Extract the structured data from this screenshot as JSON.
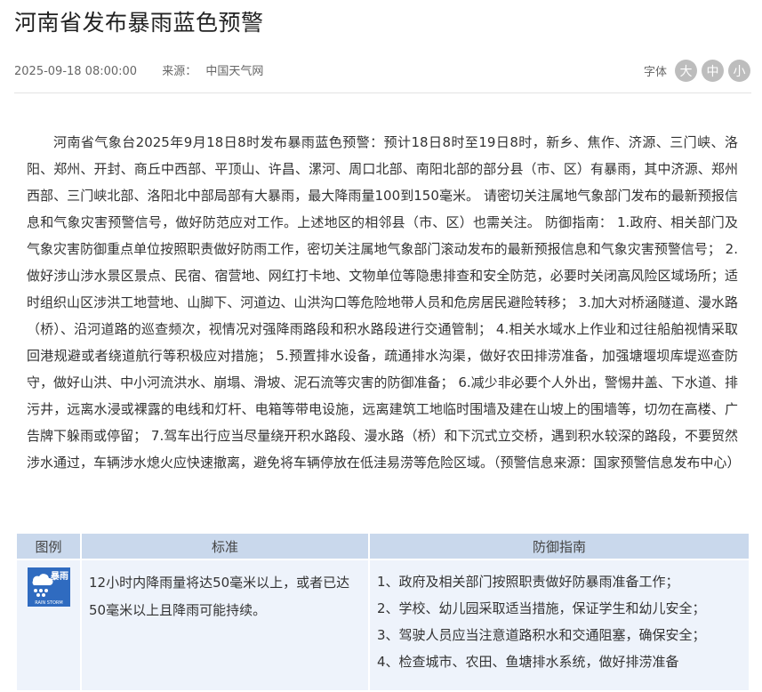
{
  "article": {
    "title": "河南省发布暴雨蓝色预警",
    "date": "2025-09-18 08:00:00",
    "source_label": "来源：",
    "source": "中国天气网"
  },
  "font_size": {
    "label": "字体",
    "large": "大",
    "medium": "中",
    "small": "小"
  },
  "body": "河南省气象台2025年9月18日8时发布暴雨蓝色预警：预计18日8时至19日8时，新乡、焦作、济源、三门峡、洛阳、郑州、开封、商丘中西部、平顶山、许昌、漯河、周口北部、南阳北部的部分县（市、区）有暴雨，其中济源、郑州西部、三门峡北部、洛阳北中部局部有大暴雨，最大降雨量100到150毫米。 请密切关注属地气象部门发布的最新预报信息和气象灾害预警信号，做好防范应对工作。上述地区的相邻县（市、区）也需关注。 防御指南： 1.政府、相关部门及气象灾害防御重点单位按照职责做好防雨工作，密切关注属地气象部门滚动发布的最新预报信息和气象灾害预警信号； 2.做好涉山涉水景区景点、民宿、宿营地、网红打卡地、文物单位等隐患排查和安全防范，必要时关闭高风险区域场所；适时组织山区涉洪工地营地、山脚下、河道边、山洪沟口等危险地带人员和危房居民避险转移； 3.加大对桥涵隧道、漫水路（桥）、沿河道路的巡查频次，视情况对强降雨路段和积水路段进行交通管制； 4.相关水域水上作业和过往船舶视情采取回港规避或者绕道航行等积极应对措施； 5.预置排水设备，疏通排水沟渠，做好农田排涝准备，加强塘堰坝库堤巡查防守，做好山洪、中小河流洪水、崩塌、滑坡、泥石流等灾害的防御准备； 6.减少非必要个人外出，警惕井盖、下水道、排污井，远离水浸或裸露的电线和灯杆、电箱等带电设施，远离建筑工地临时围墙及建在山坡上的围墙等，切勿在高楼、广告牌下躲雨或停留； 7.驾车出行应当尽量绕开积水路段、漫水路（桥）和下沉式立交桥，遇到积水较深的路段，不要贸然涉水通过，车辆涉水熄火应快速撤离，避免将车辆停放在低洼易涝等危险区域。（预警信息来源：国家预警信息发布中心）",
  "table": {
    "headers": [
      "图例",
      "标准",
      "防御指南"
    ],
    "icon": {
      "name": "rainstorm-blue-icon",
      "text_cn": "暴雨",
      "text_en": "RAIN STORM",
      "color": "#2f6bc0"
    },
    "standard": "12小时内降雨量将达50毫米以上，或者已达50毫米以上且降雨可能持续。",
    "guide": [
      "1、政府及相关部门按照职责做好防暴雨准备工作；",
      "2、学校、幼儿园采取适当措施，保证学生和幼儿安全；",
      "3、驾驶人员应当注意道路积水和交通阻塞，确保安全；",
      "4、检查城市、农田、鱼塘排水系统，做好排涝准备"
    ]
  }
}
